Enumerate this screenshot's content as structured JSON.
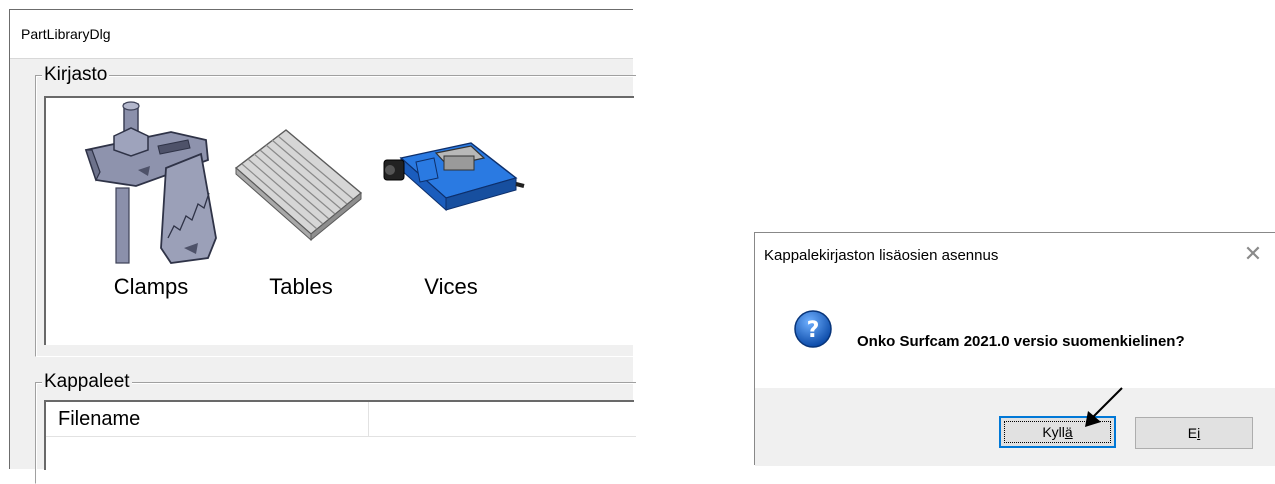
{
  "left_window": {
    "title": "PartLibraryDlg",
    "library_group": {
      "label": "Kirjasto",
      "items": [
        {
          "label": "Clamps",
          "icon": "clamp-icon"
        },
        {
          "label": "Tables",
          "icon": "table-icon"
        },
        {
          "label": "Vices",
          "icon": "vice-icon"
        }
      ]
    },
    "parts_group": {
      "label": "Kappaleet",
      "columns": [
        "Filename",
        ""
      ]
    }
  },
  "dialog": {
    "title": "Kappalekirjaston lisäosien asennus",
    "message": "Onko Surfcam 2021.0 versio suomenkielinen?",
    "yes_button": {
      "prefix": "Kyll",
      "underlined": "ä"
    },
    "no_button": {
      "prefix": "E",
      "underlined": "i"
    },
    "close_icon": "close-icon",
    "message_icon": "question-icon"
  },
  "colors": {
    "dialog_border": "#888888",
    "focus_blue": "#0078d7",
    "clamp": "#8a8fa8",
    "vice": "#1f6fd6"
  }
}
